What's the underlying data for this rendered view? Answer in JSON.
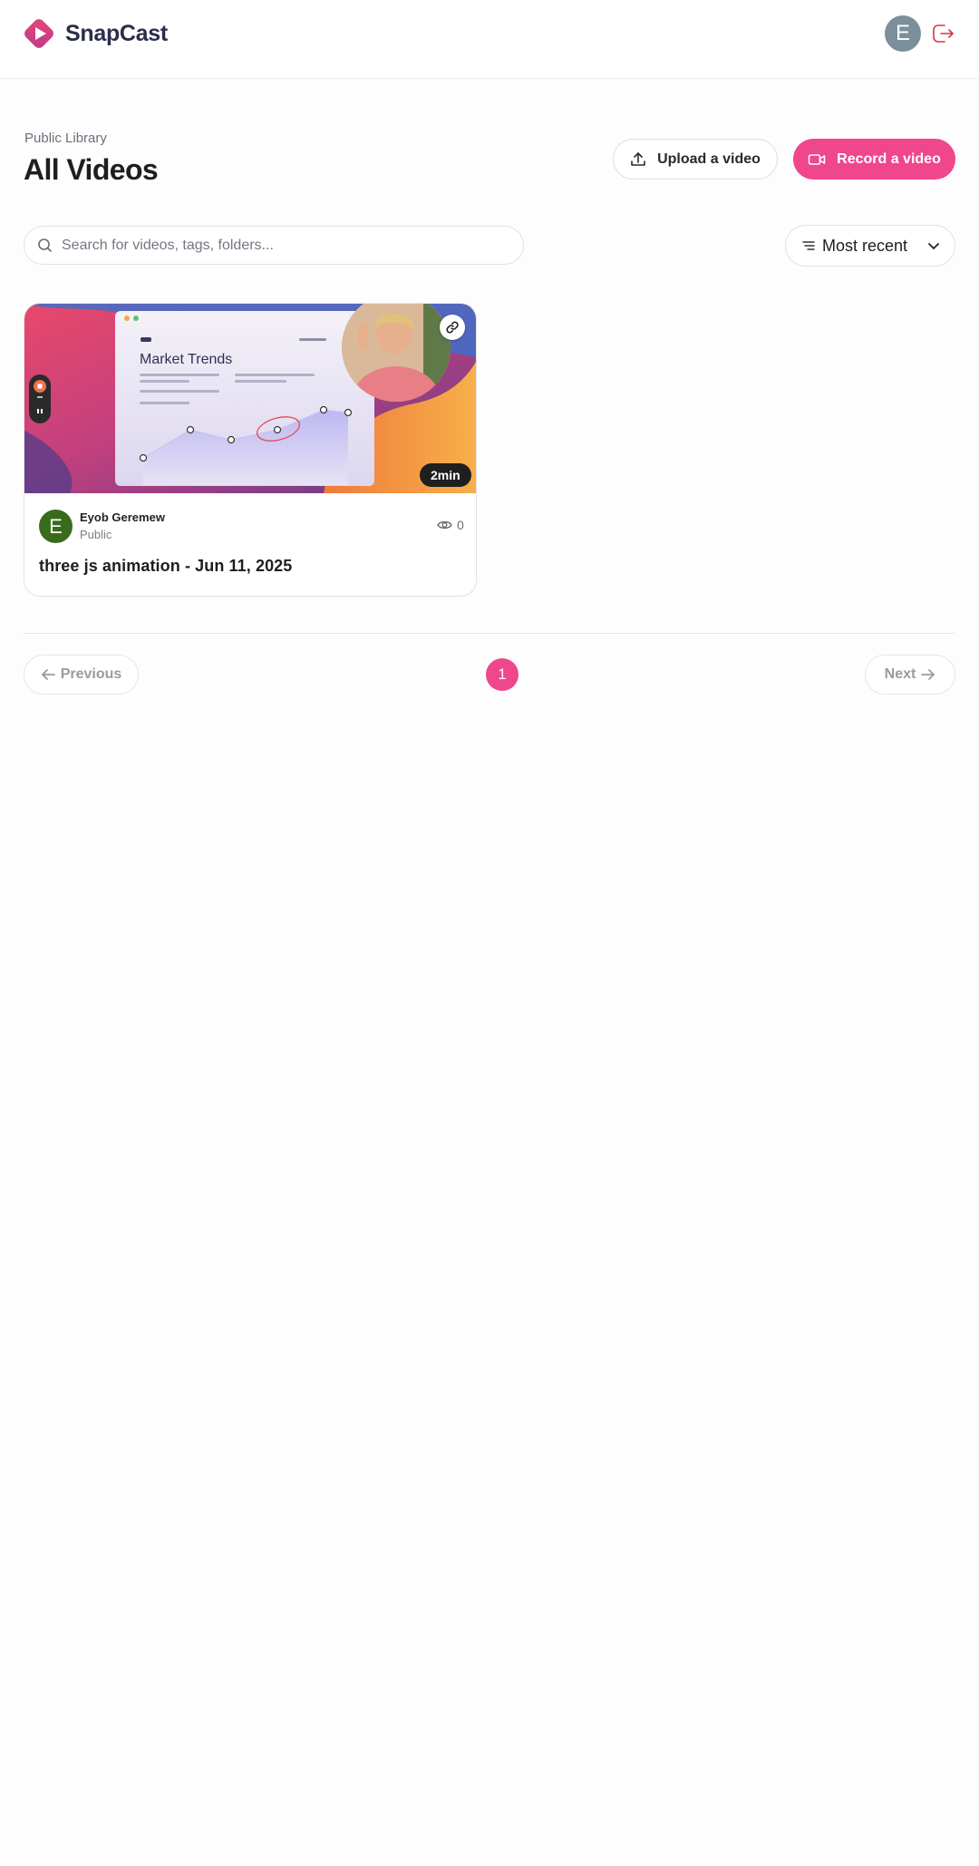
{
  "header": {
    "app_name": "SnapCast",
    "user_initial": "E",
    "accent_color": "#f0468c"
  },
  "page": {
    "subtitle": "Public Library",
    "title": "All Videos"
  },
  "actions": {
    "upload_label": "Upload a video",
    "record_label": "Record a video"
  },
  "search": {
    "placeholder": "Search for videos, tags, folders...",
    "value": ""
  },
  "sort": {
    "selected": "Most recent"
  },
  "videos": [
    {
      "thumbnail_title": "Market Trends",
      "duration": "2min",
      "author_initial": "E",
      "author_name": "Eyob Geremew",
      "visibility": "Public",
      "views": "0",
      "title": "three js animation - Jun 11, 2025"
    }
  ],
  "pagination": {
    "previous_label": "Previous",
    "next_label": "Next",
    "current_page": "1"
  }
}
